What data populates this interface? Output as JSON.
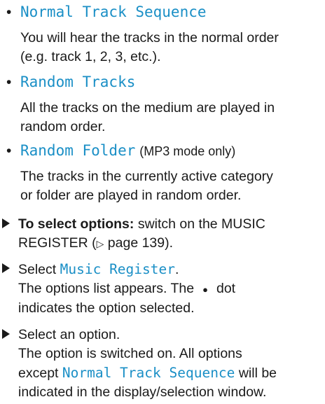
{
  "options": [
    {
      "label": "Normal Track Sequence",
      "note": "",
      "description_l1": "You will hear the tracks in the normal order",
      "description_l2": "(e.g. track 1, 2, 3, etc.)."
    },
    {
      "label": "Random Tracks",
      "note": "",
      "description_l1": "All the tracks on the medium are played in",
      "description_l2": "random order."
    },
    {
      "label": "Random Folder",
      "note": "(MP3 mode only)",
      "description_l1": "The tracks in the currently active category",
      "description_l2": "or folder are played in random order."
    }
  ],
  "steps": {
    "s1": {
      "bold": "To select options:",
      "text_a": " switch on the MUSIC",
      "text_b": "REGISTER (",
      "ref_symbol": "▷",
      "text_c": " page 139)."
    },
    "s2": {
      "text_a": "Select ",
      "ui": "Music Register",
      "text_b": ".",
      "line2": "The options list appears. The",
      "dot": "●",
      "line2_end": "dot",
      "line3": "indicates the option selected."
    },
    "s3": {
      "line1": "Select an option.",
      "line2": "The option is switched on. All options",
      "line3_a": "except ",
      "line3_ui": "Normal Track Sequence",
      "line3_b": " will be",
      "line4": "indicated in the display/selection window."
    }
  }
}
